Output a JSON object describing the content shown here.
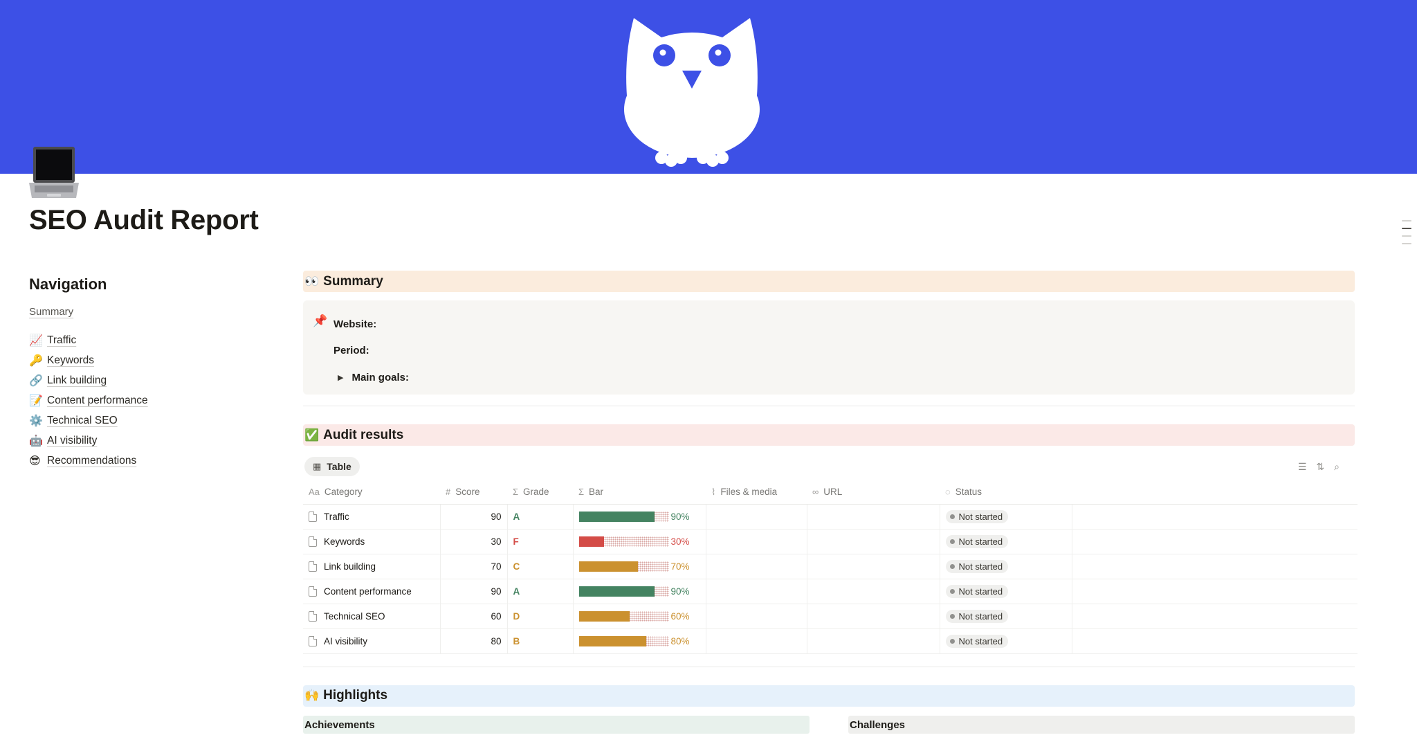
{
  "page": {
    "title": "SEO Audit Report",
    "icon": "laptop-icon",
    "cover": "owl-illustration",
    "cover_color": "#3d50e6"
  },
  "navigation": {
    "title": "Navigation",
    "summary": "Summary",
    "items": [
      {
        "emoji": "📈",
        "label": "Traffic"
      },
      {
        "emoji": "🔑",
        "label": "Keywords"
      },
      {
        "emoji": "🔗",
        "label": "Link building"
      },
      {
        "emoji": "📝",
        "label": "Content performance"
      },
      {
        "emoji": "⚙️",
        "label": "Technical SEO"
      },
      {
        "emoji": "🤖",
        "label": "AI visibility"
      },
      {
        "emoji": "😎",
        "label": "Recommendations"
      }
    ]
  },
  "summary": {
    "emoji": "👀",
    "title": "Summary",
    "callout_emoji": "📌",
    "website_label": "Website:",
    "period_label": "Period:",
    "goals_label": "Main goals:"
  },
  "audit": {
    "emoji": "✅",
    "title": "Audit results",
    "view_label": "Table",
    "columns": [
      "Category",
      "Score",
      "Grade",
      "Bar",
      "Files & media",
      "URL",
      "Status"
    ],
    "rows": [
      {
        "category": "Traffic",
        "score": "90",
        "grade": "A",
        "bar": 0.9,
        "pct": "90%",
        "status": "Not started"
      },
      {
        "category": "Keywords",
        "score": "30",
        "grade": "F",
        "bar": 0.3,
        "pct": "30%",
        "status": "Not started"
      },
      {
        "category": "Link building",
        "score": "70",
        "grade": "C",
        "bar": 0.7,
        "pct": "70%",
        "status": "Not started"
      },
      {
        "category": "Content performance",
        "score": "90",
        "grade": "A",
        "bar": 0.9,
        "pct": "90%",
        "status": "Not started"
      },
      {
        "category": "Technical SEO",
        "score": "60",
        "grade": "D",
        "bar": 0.6,
        "pct": "60%",
        "status": "Not started"
      },
      {
        "category": "AI visibility",
        "score": "80",
        "grade": "B",
        "bar": 0.8,
        "pct": "80%",
        "status": "Not started"
      }
    ],
    "grade_colors": {
      "A": "#448361",
      "B": "#cb912f",
      "C": "#cb912f",
      "D": "#cb912f",
      "F": "#d44c47"
    }
  },
  "highlights": {
    "emoji": "🙌",
    "title": "Highlights",
    "achievements": "Achievements",
    "challenges": "Challenges"
  }
}
